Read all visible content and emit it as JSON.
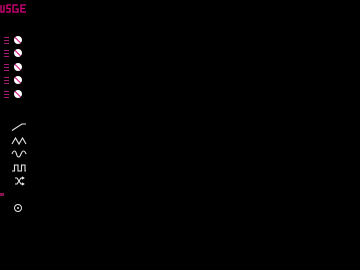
{
  "brand": {
    "logo_text": "USGE",
    "color": "#e0007f"
  },
  "channels": [
    {
      "id": "ch1",
      "state": "muted"
    },
    {
      "id": "ch2",
      "state": "muted"
    },
    {
      "id": "ch3",
      "state": "muted"
    },
    {
      "id": "ch4",
      "state": "muted"
    },
    {
      "id": "ch5",
      "state": "muted"
    }
  ],
  "waveforms": [
    "sawtooth-wave-icon",
    "triangle-wave-icon",
    "sine-wave-icon",
    "square-wave-icon",
    "random-shuffle-icon"
  ],
  "colors": {
    "accent": "#e0007f",
    "dim_accent": "#a61a76",
    "icon": "#e6e6e6",
    "background": "#000000"
  }
}
